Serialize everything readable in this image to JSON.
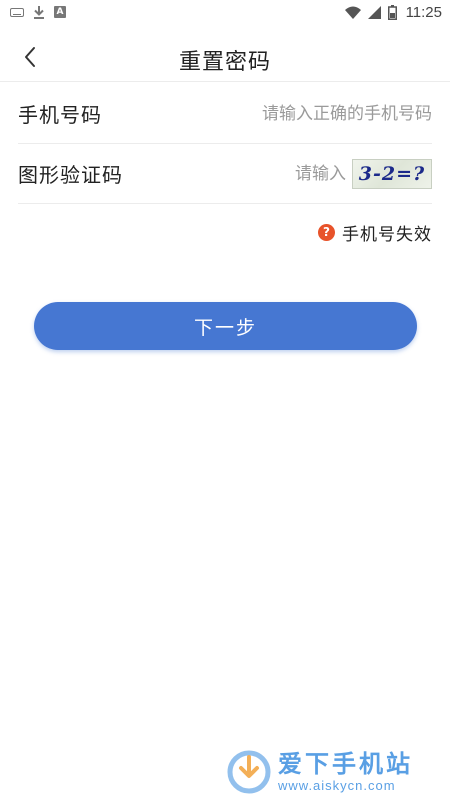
{
  "status_bar": {
    "time": "11:25",
    "icons": [
      "keyboard-icon",
      "download-icon",
      "a-icon",
      "wifi-icon",
      "signal-icon",
      "battery-icon"
    ]
  },
  "header": {
    "title": "重置密码",
    "back_icon": "chevron-left-icon"
  },
  "form": {
    "phone": {
      "label": "手机号码",
      "value": "",
      "placeholder": "请输入正确的手机号码"
    },
    "captcha": {
      "label": "图形验证码",
      "value": "",
      "placeholder": "请输入",
      "image_text": "3-2=?"
    }
  },
  "hint": {
    "icon": "question-circle-icon",
    "icon_glyph": "?",
    "text": "手机号失效",
    "icon_color": "#e8532a"
  },
  "next_button": {
    "label": "下一步",
    "color": "#4677d2"
  },
  "watermark": {
    "title": "爱下手机站",
    "url": "www.aiskycn.com",
    "color": "#3d8fe0"
  }
}
